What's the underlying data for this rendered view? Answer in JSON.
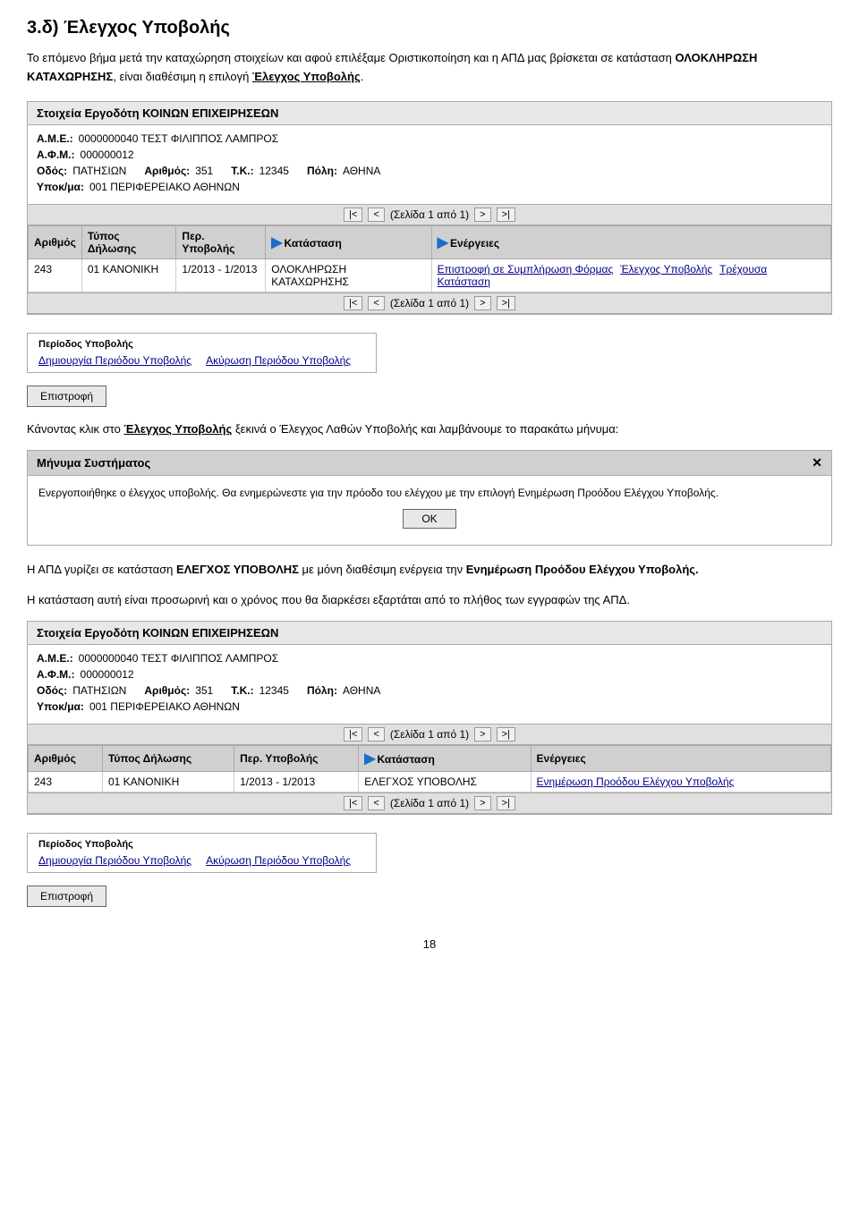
{
  "page": {
    "title": "3.δ) Έλεγχος Υποβολής",
    "intro": "Το επόμενο βήμα μετά την καταχώρηση στοιχείων και αφού επιλέξαμε Οριστικοποίηση και η ΑΠΔ μας βρίσκεται σε κατάσταση ",
    "intro_bold": "ΟΛΟΚΛΗΡΩΣΗ ΚΑΤΑΧΩΡΗΣΗΣ",
    "intro_end": ", είναι διαθέσιμη η επιλογή ",
    "intro_bold2": "Έλεγχος Υποβολής",
    "intro_end2": ".",
    "page_number": "18"
  },
  "panel1": {
    "header": "Στοιχεία Εργοδότη ΚΟΙΝΩΝ ΕΠΙΧΕΙΡΗΣΕΩΝ",
    "ame_label": "Α.Μ.Ε.:",
    "ame_value": "0000000040 ΤΕΣΤ ΦΙΛΙΠΠΟΣ ΛΑΜΠΡΟΣ",
    "afm_label": "Α.Φ.Μ.:",
    "afm_value": "000000012",
    "odos_label": "Οδός:",
    "odos_value": "ΠΑΤΗΣΙΩΝ",
    "arithmos_label": "Αριθμός:",
    "arithmos_value": "351",
    "tk_label": "Τ.Κ.:",
    "tk_value": "12345",
    "poli_label": "Πόλη:",
    "poli_value": "ΑΘΗΝΑ",
    "ypok_label": "Υποκ/μα:",
    "ypok_value": "001 ΠΕΡΙΦΕΡΕΙΑΚΟ ΑΘΗΝΩΝ",
    "pagination": {
      "text": "(Σελίδα 1 από 1)",
      "first": "|<",
      "prev": "<",
      "next": ">",
      "last": ">|"
    },
    "table": {
      "headers": [
        "Αριθμός",
        "Τύπος Δήλωσης",
        "Περ. Υποβολής",
        "Κατάσταση",
        "Ενέργειες"
      ],
      "rows": [
        {
          "arithmos": "243",
          "tipos": "01 ΚΑΝΟΝΙΚΗ",
          "period": "1/2013 - 1/2013",
          "katastasi": "ΟΛΟΚΛΗΡΩΣΗ ΚΑΤΑΧΩΡΗΣΗΣ",
          "energeies": [
            "Επιστροφή σε Συμπλήρωση Φόρμας",
            "Έλεγχος Υποβολής",
            "Τρέχουσα Κατάσταση"
          ]
        }
      ]
    }
  },
  "period_section1": {
    "label": "Περίοδος Υποβολής",
    "links": [
      "Δημιουργία Περιόδου Υποβολής",
      "Ακύρωση Περιόδου Υποβολής"
    ]
  },
  "button1": {
    "label": "Επιστροφή"
  },
  "click_text": {
    "part1": "Κάνοντας κλικ στο ",
    "bold": "Έλεγχος Υποβολής",
    "part2": " ξεκινά ο Έλεγχος Λαθών Υποβολής και λαμβάνουμε το παρακάτω μήνυμα:"
  },
  "message": {
    "header": "Μήνυμα Συστήματος",
    "close": "✕",
    "body1": "Ενεργοποιήθηκε ο έλεγχος υποβολής. Θα ενημερώνεστε για την πρόοδο του ελέγχου με την επιλογή Ενημέρωση Προόδου Ελέγχου Υποβολής.",
    "ok": "ΟΚ"
  },
  "apd_text": {
    "part1": "Η ΑΠΔ γυρίζει σε κατάσταση ",
    "bold1": "ΕΛΕΓΧΟΣ ΥΠΟΒΟΛΗΣ",
    "part2": " με μόνη διαθέσιμη ενέργεια την ",
    "bold2": "Ενημέρωση Προόδου Ελέγχου Υποβολής.",
    "part3": " Η κατάσταση αυτή είναι προσωρινή και ο χρόνος που θα διαρκέσει εξαρτάται από το πλήθος των εγγραφών της ΑΠΔ."
  },
  "panel2": {
    "header": "Στοιχεία Εργοδότη ΚΟΙΝΩΝ ΕΠΙΧΕΙΡΗΣΕΩΝ",
    "ame_label": "Α.Μ.Ε.:",
    "ame_value": "0000000040 ΤΕΣΤ ΦΙΛΙΠΠΟΣ ΛΑΜΠΡΟΣ",
    "afm_label": "Α.Φ.Μ.:",
    "afm_value": "000000012",
    "odos_label": "Οδός:",
    "odos_value": "ΠΑΤΗΣΙΩΝ",
    "arithmos_label": "Αριθμός:",
    "arithmos_value": "351",
    "tk_label": "Τ.Κ.:",
    "tk_value": "12345",
    "poli_label": "Πόλη:",
    "poli_value": "ΑΘΗΝΑ",
    "ypok_label": "Υποκ/μα:",
    "ypok_value": "001 ΠΕΡΙΦΕΡΕΙΑΚΟ ΑΘΗΝΩΝ",
    "pagination": {
      "text": "(Σελίδα 1 από 1)",
      "first": "|<",
      "prev": "<",
      "next": ">",
      "last": ">|"
    },
    "table": {
      "headers": [
        "Αριθμός",
        "Τύπος Δήλωσης",
        "Περ. Υποβολής",
        "Κατάσταση",
        "Ενέργειες"
      ],
      "rows": [
        {
          "arithmos": "243",
          "tipos": "01 ΚΑΝΟΝΙΚΗ",
          "period": "1/2013 - 1/2013",
          "katastasi": "ΕΛΕΓΧΟΣ ΥΠΟΒΟΛΗΣ",
          "energeies": [
            "Ενημέρωση Προόδου Ελέγχου Υποβολής"
          ]
        }
      ]
    }
  },
  "period_section2": {
    "label": "Περίοδος Υποβολής",
    "links": [
      "Δημιουργία Περιόδου Υποβολής",
      "Ακύρωση Περιόδου Υποβολής"
    ]
  },
  "button2": {
    "label": "Επιστροφή"
  }
}
